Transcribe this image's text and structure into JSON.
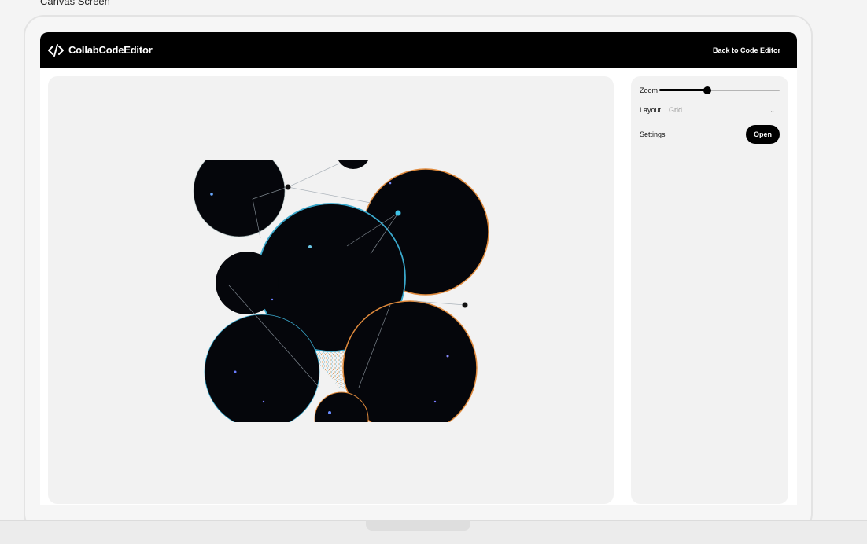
{
  "caption": "Canvas Screen",
  "app": {
    "name": "CollabCodeEditor",
    "back_label": "Back to Code Editor"
  },
  "controls": {
    "zoom_label": "Zoom",
    "zoom_level": 0.4,
    "layout_label": "Layout",
    "layout_value": "Grid",
    "settings_label": "Settings",
    "open_label": "Open"
  },
  "icons": {
    "logo": "code-icon",
    "layout_dropdown": "chevron-down-icon"
  },
  "colors": {
    "topbar": "#000000",
    "accent": "#000000",
    "panel": "#f2f2f2"
  }
}
